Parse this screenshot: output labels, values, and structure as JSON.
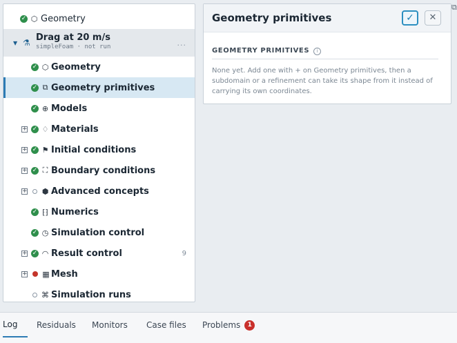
{
  "tree": {
    "top_item": {
      "label": "Geometry"
    },
    "case": {
      "title": "Drag at 20 m/s",
      "subtitle": "simpleFoam · not run",
      "more": "..."
    },
    "items": [
      {
        "label": "Geometry",
        "status": "ok",
        "icon": "cube-icon"
      },
      {
        "label": "Geometry primitives",
        "status": "ok",
        "icon": "shapes-icon",
        "selected": true
      },
      {
        "label": "Models",
        "status": "ok",
        "icon": "globe-icon"
      },
      {
        "label": "Materials",
        "status": "ok",
        "icon": "drop-icon",
        "expandable": true
      },
      {
        "label": "Initial conditions",
        "status": "ok",
        "icon": "flag-icon",
        "expandable": true
      },
      {
        "label": "Boundary conditions",
        "status": "ok",
        "icon": "bracket-box-icon",
        "expandable": true
      },
      {
        "label": "Advanced concepts",
        "status": "empty",
        "icon": "hexagon-icon",
        "expandable": true
      },
      {
        "label": "Numerics",
        "status": "ok",
        "icon": "matrix-icon"
      },
      {
        "label": "Simulation control",
        "status": "ok",
        "icon": "clock-icon"
      },
      {
        "label": "Result control",
        "status": "ok",
        "icon": "gauge-icon",
        "expandable": true,
        "count": "9"
      },
      {
        "label": "Mesh",
        "status": "error",
        "icon": "grid-icon",
        "expandable": true
      },
      {
        "label": "Simulation runs",
        "status": "empty",
        "icon": "runs-icon"
      }
    ]
  },
  "detail": {
    "title": "Geometry primitives",
    "section_title": "GEOMETRY PRIMITIVES",
    "body": "None yet. Add one with + on Geometry primitives, then a subdomain or a refinement can take its shape from it instead of carrying its own coordinates."
  },
  "tabs": [
    {
      "label": "Log",
      "active": true
    },
    {
      "label": "Residuals"
    },
    {
      "label": "Monitors"
    },
    {
      "label": "Case files"
    },
    {
      "label": "Problems",
      "badge": "1"
    }
  ],
  "colors": {
    "accent": "#2c7bb4",
    "ok": "#2f8f4c",
    "error": "#c4352b",
    "selected_bg": "#d7e8f3"
  }
}
